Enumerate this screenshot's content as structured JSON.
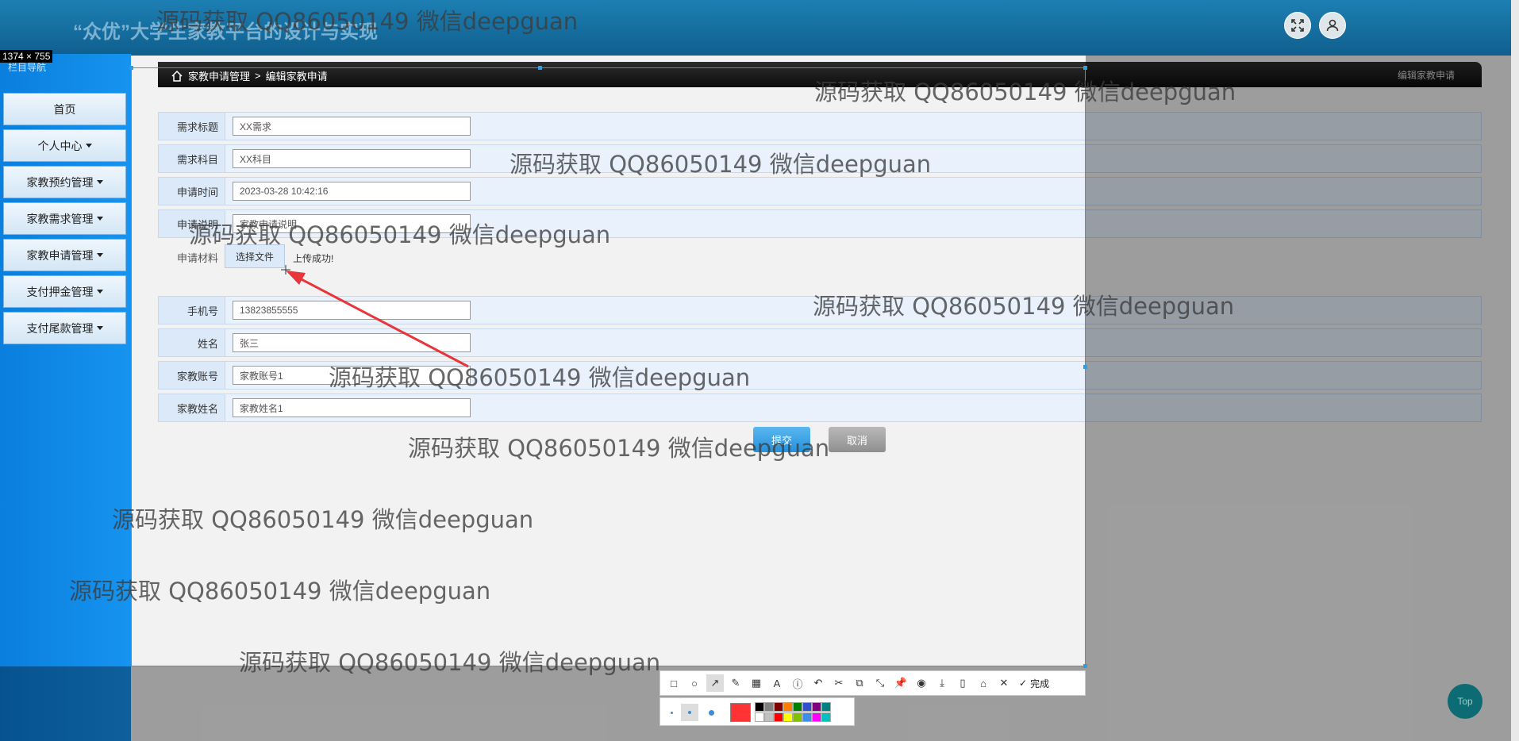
{
  "app": {
    "title": "“众优”大学生家教平台的设计与实现",
    "size_badge": "1374 × 755",
    "nav_title": "栏目导航"
  },
  "sidebar": {
    "items": [
      {
        "label": "首页",
        "has_caret": false
      },
      {
        "label": "个人中心",
        "has_caret": true
      },
      {
        "label": "家教预约管理",
        "has_caret": true
      },
      {
        "label": "家教需求管理",
        "has_caret": true
      },
      {
        "label": "家教申请管理",
        "has_caret": true
      },
      {
        "label": "支付押金管理",
        "has_caret": true
      },
      {
        "label": "支付尾款管理",
        "has_caret": true
      }
    ]
  },
  "breadcrumb": {
    "section": "家教申请管理",
    "separator": ">",
    "page": "编辑家教申请",
    "right_title": "编辑家教申请"
  },
  "form": {
    "fields": [
      {
        "label": "需求标题",
        "value": "XX需求"
      },
      {
        "label": "需求科目",
        "value": "XX科目"
      },
      {
        "label": "申请时间",
        "value": "2023-03-28 10:42:16"
      },
      {
        "label": "申请说明",
        "value": "家教申请说明"
      },
      {
        "label": "手机号",
        "value": "13823855555"
      },
      {
        "label": "姓名",
        "value": "张三"
      },
      {
        "label": "家教账号",
        "value": "家教账号1"
      },
      {
        "label": "家教姓名",
        "value": "家教姓名1"
      }
    ],
    "file": {
      "label": "申请材料",
      "button": "选择文件",
      "status": "上传成功!"
    },
    "submit_label": "提交",
    "cancel_label": "取消"
  },
  "watermark_text": "源码获取 QQ86050149 微信deepguan",
  "toolbar": {
    "done_label": "完成",
    "colors": [
      "#000000",
      "#808080",
      "#800000",
      "#ff8000",
      "#008000",
      "#3050d0",
      "#800080",
      "#008080",
      "#ffffff",
      "#c0c0c0",
      "#ff0000",
      "#ffff00",
      "#80c000",
      "#3b8fe8",
      "#ff00ff",
      "#00c0c0"
    ],
    "selected_color": "#ff3333"
  },
  "top_button": "Top"
}
